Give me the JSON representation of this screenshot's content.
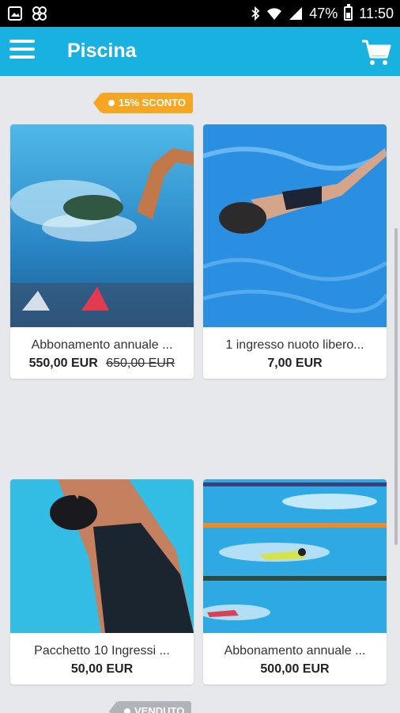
{
  "status_bar": {
    "battery": "47%",
    "time": "11:50"
  },
  "app_bar": {
    "title": "Piscina"
  },
  "badges": {
    "sale": "15% SCONTO",
    "sold": "VENDUTO"
  },
  "products": [
    {
      "name": "Abbonamento annuale ...",
      "price": "550,00 EUR",
      "old_price": "650,00 EUR"
    },
    {
      "name": "1 ingresso nuoto libero...",
      "price": "7,00 EUR"
    },
    {
      "name": "Pacchetto 10 Ingressi ...",
      "price": "50,00 EUR"
    },
    {
      "name": "Abbonamento annuale ...",
      "price": "500,00 EUR"
    }
  ],
  "colors": {
    "primary": "#19b2e0",
    "sale_badge": "#f5a623",
    "sold_badge": "#b0b3b8",
    "background": "#e6e8ec"
  },
  "icons": [
    "image-icon",
    "app-icon",
    "bluetooth-icon",
    "wifi-icon",
    "signal-icon",
    "battery-icon",
    "menu-icon",
    "cart-icon"
  ]
}
